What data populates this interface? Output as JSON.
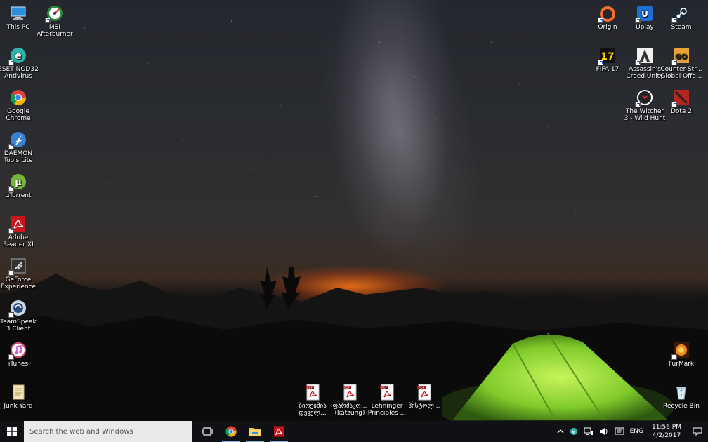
{
  "desktop": {
    "icons_left": [
      {
        "label": "This PC",
        "icon": "computer-icon"
      },
      {
        "label": "ESET NOD32 Antivirus",
        "icon": "eset-icon"
      },
      {
        "label": "Google Chrome",
        "icon": "chrome-icon"
      },
      {
        "label": "DAEMON Tools Lite",
        "icon": "daemon-tools-icon"
      },
      {
        "label": "µTorrent",
        "icon": "utorrent-icon"
      },
      {
        "label": "Adobe Reader XI",
        "icon": "adobe-reader-icon"
      },
      {
        "label": "GeForce Experience",
        "icon": "geforce-icon"
      },
      {
        "label": "TeamSpeak 3 Client",
        "icon": "teamspeak-icon"
      },
      {
        "label": "iTunes",
        "icon": "itunes-icon"
      },
      {
        "label": "Junk Yard",
        "icon": "folder-icon"
      }
    ],
    "msi": {
      "label": "MSI Afterburner",
      "icon": "msi-afterburner-icon"
    },
    "icons_right": [
      {
        "label": "Origin",
        "icon": "origin-icon"
      },
      {
        "label": "Uplay",
        "icon": "uplay-icon"
      },
      {
        "label": "Steam",
        "icon": "steam-icon"
      },
      {
        "label": "FIFA 17",
        "icon": "fifa-icon"
      },
      {
        "label": "Assassin's Creed Unity",
        "icon": "assassins-creed-icon"
      },
      {
        "label": "Counter-Str... Global Offe...",
        "icon": "csgo-icon"
      },
      {
        "label": "The Witcher 3 - Wild Hunt",
        "icon": "witcher-icon"
      },
      {
        "label": "Dota 2",
        "icon": "dota-icon"
      },
      {
        "label": "FurMark",
        "icon": "furmark-icon"
      },
      {
        "label": "Recycle Bin",
        "icon": "recycle-bin-icon"
      }
    ],
    "pdf_files": [
      {
        "label": "ბიოქიმია დეველ...",
        "icon": "pdf-icon"
      },
      {
        "label": "ფარმაკო... (katzung)",
        "icon": "pdf-icon"
      },
      {
        "label": "Lehninger Principles ...",
        "icon": "pdf-icon"
      },
      {
        "label": "ჰისტოლ...",
        "icon": "pdf-icon"
      }
    ]
  },
  "taskbar": {
    "search_placeholder": "Search the web and Windows",
    "pinned": [
      "task-view-icon",
      "chrome-icon",
      "file-explorer-icon",
      "adobe-reader-icon"
    ],
    "tray": {
      "language": "ENG",
      "time": "11:56 PM",
      "date": "4/2/2017"
    }
  }
}
